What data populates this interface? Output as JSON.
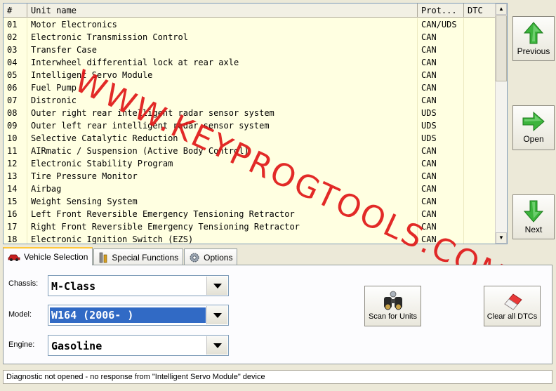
{
  "table": {
    "headers": {
      "num": "#",
      "name": "Unit name",
      "protocol": "Prot...",
      "dtc": "DTC"
    },
    "rows": [
      {
        "num": "01",
        "name": "Motor Electronics",
        "protocol": "CAN/UDS"
      },
      {
        "num": "02",
        "name": "Electronic Transmission Control",
        "protocol": "CAN"
      },
      {
        "num": "03",
        "name": "Transfer Case",
        "protocol": "CAN"
      },
      {
        "num": "04",
        "name": "Interwheel differential lock at rear axle",
        "protocol": "CAN"
      },
      {
        "num": "05",
        "name": "Intelligent Servo Module",
        "protocol": "CAN"
      },
      {
        "num": "06",
        "name": "Fuel Pump",
        "protocol": "CAN"
      },
      {
        "num": "07",
        "name": "Distronic",
        "protocol": "CAN"
      },
      {
        "num": "08",
        "name": "Outer right rear intelligent radar sensor system",
        "protocol": "UDS"
      },
      {
        "num": "09",
        "name": "Outer left rear intelligent radar sensor system",
        "protocol": "UDS"
      },
      {
        "num": "10",
        "name": "Selective Catalytic Reduction",
        "protocol": "UDS"
      },
      {
        "num": "11",
        "name": "AIRmatic / Suspension (Active Body Control)",
        "protocol": "CAN"
      },
      {
        "num": "12",
        "name": "Electronic Stability Program",
        "protocol": "CAN"
      },
      {
        "num": "13",
        "name": "Tire Pressure Monitor",
        "protocol": "CAN"
      },
      {
        "num": "14",
        "name": "Airbag",
        "protocol": "CAN"
      },
      {
        "num": "15",
        "name": "Weight Sensing System",
        "protocol": "CAN"
      },
      {
        "num": "16",
        "name": "Left Front Reversible Emergency Tensioning Retractor",
        "protocol": "CAN"
      },
      {
        "num": "17",
        "name": "Right Front Reversible Emergency Tensioning Retractor",
        "protocol": "CAN"
      },
      {
        "num": "18",
        "name": "Electronic Ignition Switch (EZS)",
        "protocol": "CAN"
      }
    ]
  },
  "nav": {
    "previous_label": "Previous",
    "open_label": "Open",
    "next_label": "Next"
  },
  "tabs": {
    "vehicle_selection": "Vehicle Selection",
    "special_functions": "Special Functions",
    "options": "Options"
  },
  "vehicle": {
    "chassis_label": "Chassis:",
    "chassis_value": "M-Class",
    "model_label": "Model:",
    "model_value": "W164 (2006- )",
    "engine_label": "Engine:",
    "engine_value": "Gasoline"
  },
  "actions": {
    "scan_label": "Scan for Units",
    "clear_label": "Clear all DTCs"
  },
  "status_text": "Diagnostic not opened - no response from \"Intelligent Servo Module\" device",
  "watermark_text": "WWW.KEYPROGTOOLS.COM",
  "colors": {
    "grid_background": "#ffffe1",
    "watermark": "#e01818",
    "arrow_green": "#3cb43c",
    "selection": "#316ac5"
  },
  "icons": {
    "previous": "green-up-arrow-icon",
    "open": "green-right-arrow-icon",
    "next": "green-down-arrow-icon",
    "scan": "binoculars-icon",
    "clear": "eraser-icon",
    "vehicle_tab": "car-icon",
    "special_tab": "tools-icon",
    "options_tab": "gear-icon"
  }
}
